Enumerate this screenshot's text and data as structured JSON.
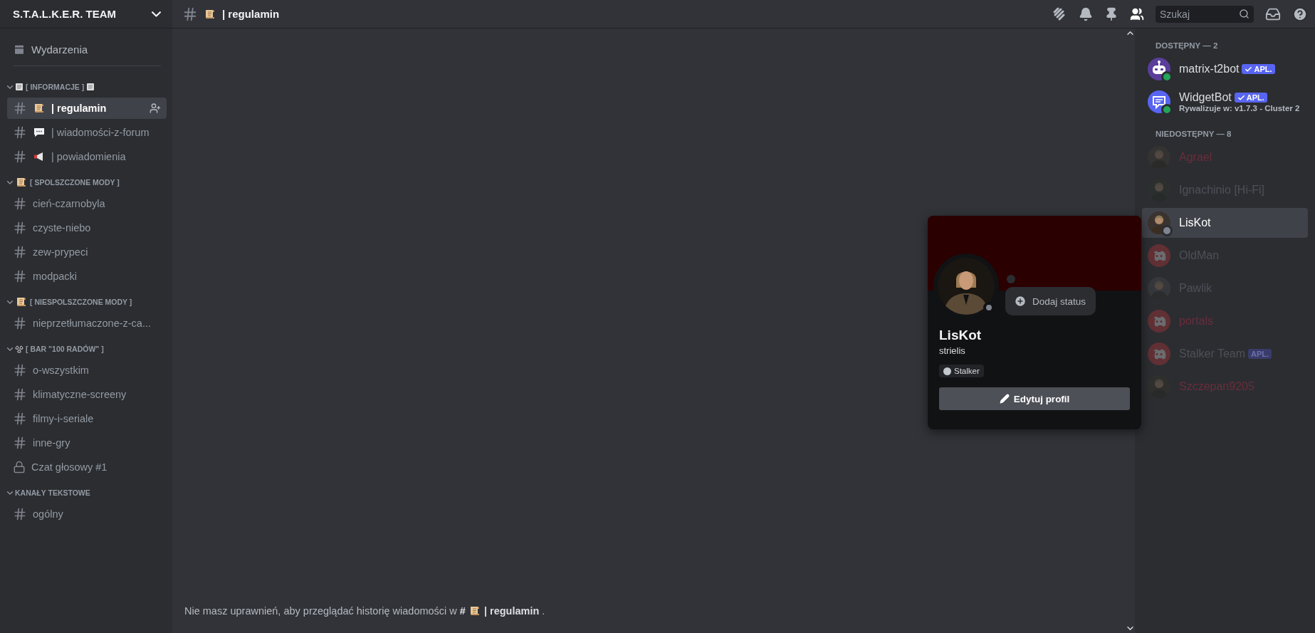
{
  "server": {
    "name": "S.T.A.L.K.E.R. TEAM"
  },
  "sidebar": {
    "events": {
      "label": "Wydarzenia"
    },
    "categories": [
      {
        "label": "[ INFORMACJE ]",
        "expanded": true,
        "icon_before": {
          "kind": "page"
        },
        "icon_after": {
          "kind": "page"
        },
        "channels": [
          {
            "name": "| regulamin",
            "kind": "text",
            "emoji": {
              "kind": "scroll"
            },
            "selected": true
          },
          {
            "name": "| wiadomości-z-forum",
            "kind": "text",
            "emoji": {
              "kind": "speech"
            },
            "selected": false
          },
          {
            "name": "| powiadomienia",
            "kind": "text",
            "emoji": {
              "kind": "megaphone"
            },
            "selected": false
          }
        ]
      },
      {
        "label": "[ SPOLSZCZONE MODY ]",
        "expanded": true,
        "icon_before": {
          "kind": "scroll"
        },
        "channels": [
          {
            "name": "cień-czarnobyla",
            "kind": "text",
            "selected": false
          },
          {
            "name": "czyste-niebo",
            "kind": "text",
            "selected": false
          },
          {
            "name": "zew-prypeci",
            "kind": "text",
            "selected": false
          },
          {
            "name": "modpacki",
            "kind": "text",
            "selected": false
          }
        ]
      },
      {
        "label": "[ NIESPOLSZCZONE MODY ]",
        "expanded": true,
        "icon_before": {
          "kind": "scroll"
        },
        "channels": [
          {
            "name": "nieprzetłumaczone-z-ca...",
            "kind": "text",
            "selected": false
          }
        ]
      },
      {
        "label": "[ BAR \"100 RADÓW\" ]",
        "expanded": true,
        "icon_before": {
          "kind": "radiation"
        },
        "channels": [
          {
            "name": "o-wszystkim",
            "kind": "text",
            "selected": false
          },
          {
            "name": "klimatyczne-screeny",
            "kind": "text",
            "selected": false
          },
          {
            "name": "filmy-i-seriale",
            "kind": "text",
            "selected": false
          },
          {
            "name": "inne-gry",
            "kind": "text",
            "selected": false
          },
          {
            "name": "Czat głosowy #1",
            "kind": "voice",
            "selected": false
          }
        ]
      },
      {
        "label": "KANAŁY TEKSTOWE",
        "expanded": true,
        "channels": [
          {
            "name": "ogólny",
            "kind": "text",
            "selected": false
          }
        ]
      }
    ]
  },
  "header": {
    "channel": "| regulamin",
    "emoji": {
      "kind": "scroll"
    },
    "search": {
      "placeholder": "Szukaj"
    },
    "members_on": true
  },
  "notice": {
    "text": "Nie masz uprawnień, aby przeglądać historię wiadomości w",
    "hash": "#",
    "channel": "| regulamin",
    "end": "."
  },
  "members": {
    "groups": [
      {
        "label": "DOSTĘPNY — 2",
        "items": [
          {
            "name": "matrix-t2bot",
            "color": "#dbdee1",
            "avatar": {
              "kind": "bot"
            },
            "online": true,
            "tag": {
              "label": "APL.",
              "verified": true
            },
            "selected": false
          },
          {
            "name": "WidgetBot",
            "color": "#dbdee1",
            "avatar": {
              "kind": "widget"
            },
            "online": true,
            "tag": {
              "label": "APL.",
              "verified": true
            },
            "activity": "Rywalizuje w: v1.7.3 - Cluster 2",
            "selected": false
          }
        ]
      },
      {
        "label": "NIEDOSTĘPNY — 8",
        "items": [
          {
            "name": "Agrael",
            "color": "#6b2d3b",
            "online": false,
            "selected": false
          },
          {
            "name": "Ignachinio [Hi-Fi]",
            "color": "#4e5058",
            "online": false,
            "selected": false
          },
          {
            "name": "LisKot",
            "color": "#ffffff",
            "online": false,
            "selected": true
          },
          {
            "name": "OldMan",
            "color": "#4e5058",
            "avatar": {
              "kind": "default"
            },
            "online": false,
            "selected": false
          },
          {
            "name": "Pawlik",
            "color": "#4e5058",
            "online": false,
            "selected": false
          },
          {
            "name": "portals",
            "color": "#6b2d3b",
            "avatar": {
              "kind": "default"
            },
            "online": false,
            "selected": false
          },
          {
            "name": "Stalker Team",
            "color": "#4e5058",
            "avatar": {
              "kind": "default"
            },
            "online": false,
            "tag": {
              "label": "APL.",
              "verified": false
            },
            "selected": false
          },
          {
            "name": "Szczepan9205",
            "color": "#6b2d3b",
            "online": false,
            "selected": false
          }
        ]
      }
    ]
  },
  "profile": {
    "name": "LisKot",
    "username": "strielis",
    "online": false,
    "add_status": "Dodaj status",
    "roles": [
      {
        "label": "Stalker",
        "color": "#c4c9ce"
      }
    ],
    "edit_button": "Edytuj profil"
  }
}
